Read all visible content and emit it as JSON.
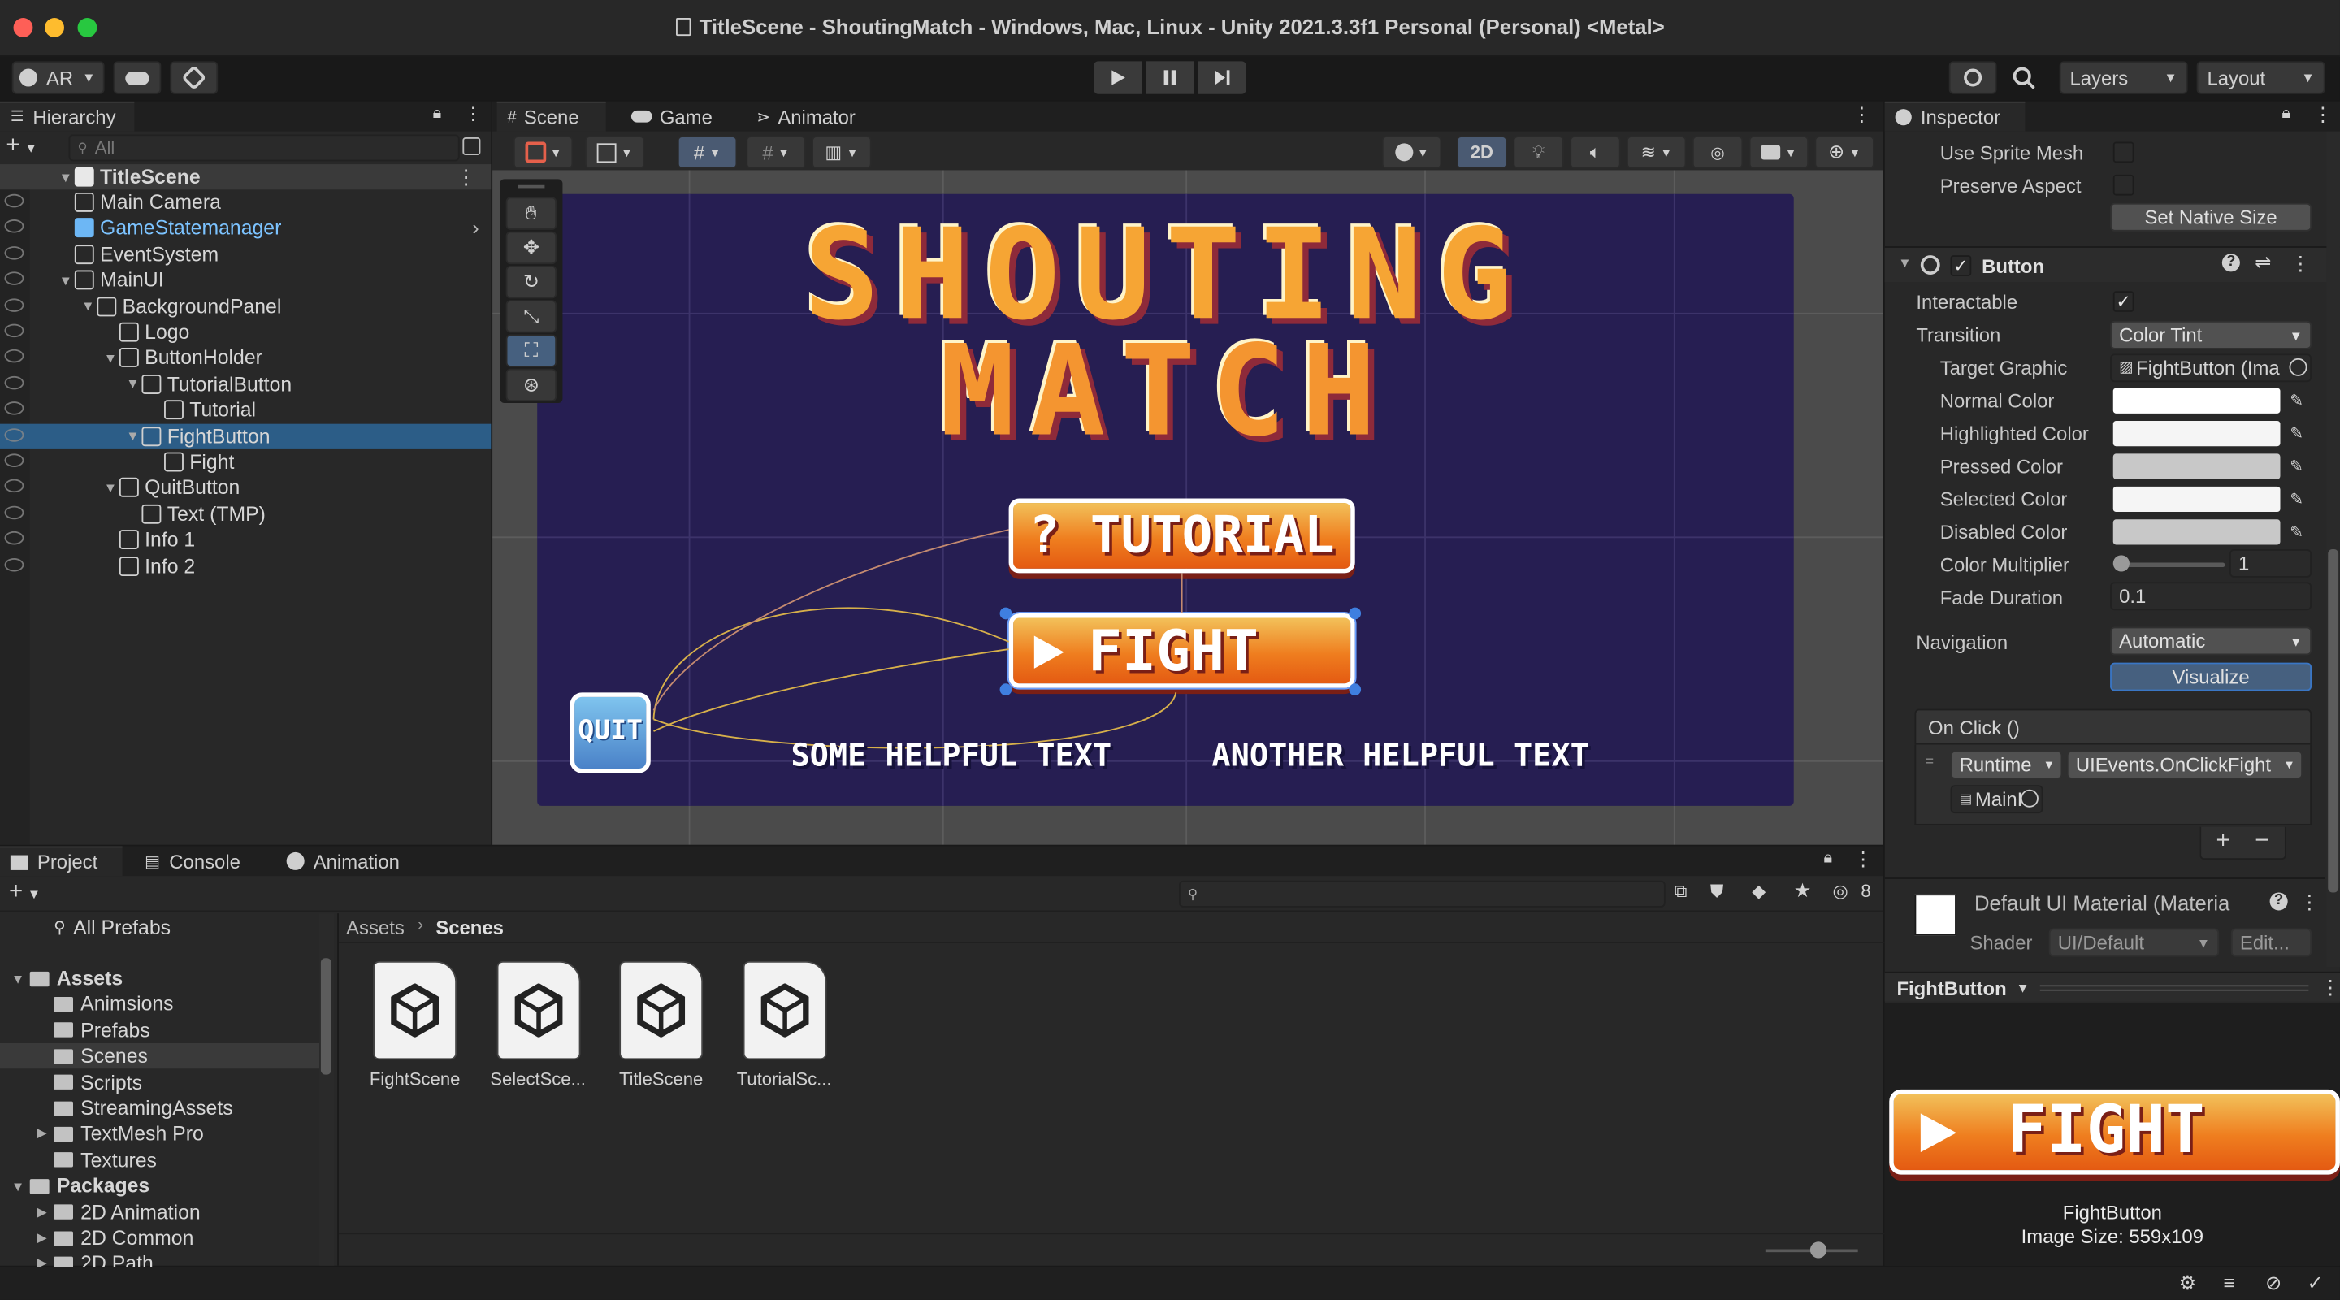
{
  "window": {
    "title": "TitleScene - ShoutingMatch - Windows, Mac, Linux - Unity 2021.3.3f1 Personal (Personal) <Metal>"
  },
  "toolbar": {
    "account": "AR",
    "layers": "Layers",
    "layout": "Layout"
  },
  "hierarchy": {
    "tab": "Hierarchy",
    "search_placeholder": "All",
    "scene": "TitleScene",
    "items": [
      {
        "label": "Main Camera"
      },
      {
        "label": "GameStatemanager"
      },
      {
        "label": "EventSystem"
      },
      {
        "label": "MainUI"
      },
      {
        "label": "BackgroundPanel"
      },
      {
        "label": "Logo"
      },
      {
        "label": "ButtonHolder"
      },
      {
        "label": "TutorialButton"
      },
      {
        "label": "Tutorial"
      },
      {
        "label": "FightButton"
      },
      {
        "label": "Fight"
      },
      {
        "label": "QuitButton"
      },
      {
        "label": "Text (TMP)"
      },
      {
        "label": "Info 1"
      },
      {
        "label": "Info 2"
      }
    ]
  },
  "scene_tabs": {
    "scene": "Scene",
    "game": "Game",
    "animator": "Animator",
    "mode_2d": "2D"
  },
  "game": {
    "title_line1": "SHOUTING",
    "title_line2": "MATCH",
    "tutorial": "? TUTORIAL",
    "fight": "FIGHT",
    "quit": "QUIT",
    "help1": "SOME HELPFUL TEXT",
    "help2": "ANOTHER HELPFUL TEXT"
  },
  "inspector": {
    "tab": "Inspector",
    "use_sprite_mesh": "Use Sprite Mesh",
    "preserve_aspect": "Preserve Aspect",
    "set_native_size": "Set Native Size",
    "component": "Button",
    "interactable": "Interactable",
    "transition": "Transition",
    "transition_value": "Color Tint",
    "target_graphic": "Target Graphic",
    "target_graphic_value": "FightButton (Ima",
    "normal_color": "Normal Color",
    "highlighted_color": "Highlighted Color",
    "pressed_color": "Pressed Color",
    "selected_color": "Selected Color",
    "disabled_color": "Disabled Color",
    "color_multiplier": "Color Multiplier",
    "color_multiplier_value": "1",
    "fade_duration": "Fade Duration",
    "fade_duration_value": "0.1",
    "navigation": "Navigation",
    "navigation_value": "Automatic",
    "visualize": "Visualize",
    "on_click": "On Click ()",
    "runtime": "Runtime",
    "function": "UIEvents.OnClickFight",
    "object": "MainI",
    "plus": "+",
    "minus": "−",
    "material": "Default UI Material (Materia",
    "shader_label": "Shader",
    "shader_value": "UI/Default",
    "edit": "Edit...",
    "preview_name": "FightButton",
    "preview_caption_name": "FightButton",
    "preview_caption_size": "Image Size: 559x109",
    "colors": {
      "normal": "#ffffff",
      "highlighted": "#f5f5f5",
      "pressed": "#c8c8c8",
      "selected": "#f5f5f5",
      "disabled": "#c8c8c8"
    }
  },
  "project": {
    "tabs": {
      "project": "Project",
      "console": "Console",
      "animation": "Animation"
    },
    "badge": "8",
    "all_prefabs": "All Prefabs",
    "tree": [
      {
        "label": "Assets",
        "bold": true
      },
      {
        "label": "Animsions"
      },
      {
        "label": "Prefabs"
      },
      {
        "label": "Scenes"
      },
      {
        "label": "Scripts"
      },
      {
        "label": "StreamingAssets"
      },
      {
        "label": "TextMesh Pro"
      },
      {
        "label": "Textures"
      },
      {
        "label": "Packages",
        "bold": true
      },
      {
        "label": "2D Animation"
      },
      {
        "label": "2D Common"
      },
      {
        "label": "2D Path"
      }
    ],
    "breadcrumb": {
      "root": "Assets",
      "current": "Scenes"
    },
    "files": [
      {
        "label": "FightScene"
      },
      {
        "label": "SelectSce..."
      },
      {
        "label": "TitleScene"
      },
      {
        "label": "TutorialSc..."
      }
    ]
  }
}
